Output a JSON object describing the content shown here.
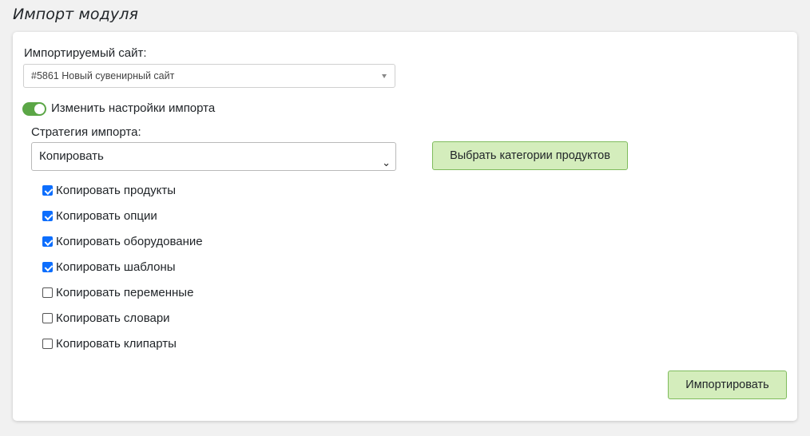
{
  "page": {
    "title": "Импорт модуля"
  },
  "form": {
    "site_label": "Импортируемый сайт:",
    "site_value": "#5861 Новый сувенирный сайт",
    "toggle_label": "Изменить настройки импорта",
    "toggle_on": true,
    "strategy_label": "Стратегия импорта:",
    "strategy_value": "Копировать",
    "categories_button": "Выбрать категории продуктов",
    "import_button": "Импортировать",
    "checkboxes": [
      {
        "label": "Копировать продукты",
        "checked": true
      },
      {
        "label": "Копировать опции",
        "checked": true
      },
      {
        "label": "Копировать оборудование",
        "checked": true
      },
      {
        "label": "Копировать шаблоны",
        "checked": true
      },
      {
        "label": "Копировать переменные",
        "checked": false
      },
      {
        "label": "Копировать словари",
        "checked": false
      },
      {
        "label": "Копировать клипарты",
        "checked": false
      }
    ]
  },
  "colors": {
    "accent_green": "#5ba646",
    "button_bg": "#d4edbc",
    "checkbox_blue": "#0d6efd"
  }
}
